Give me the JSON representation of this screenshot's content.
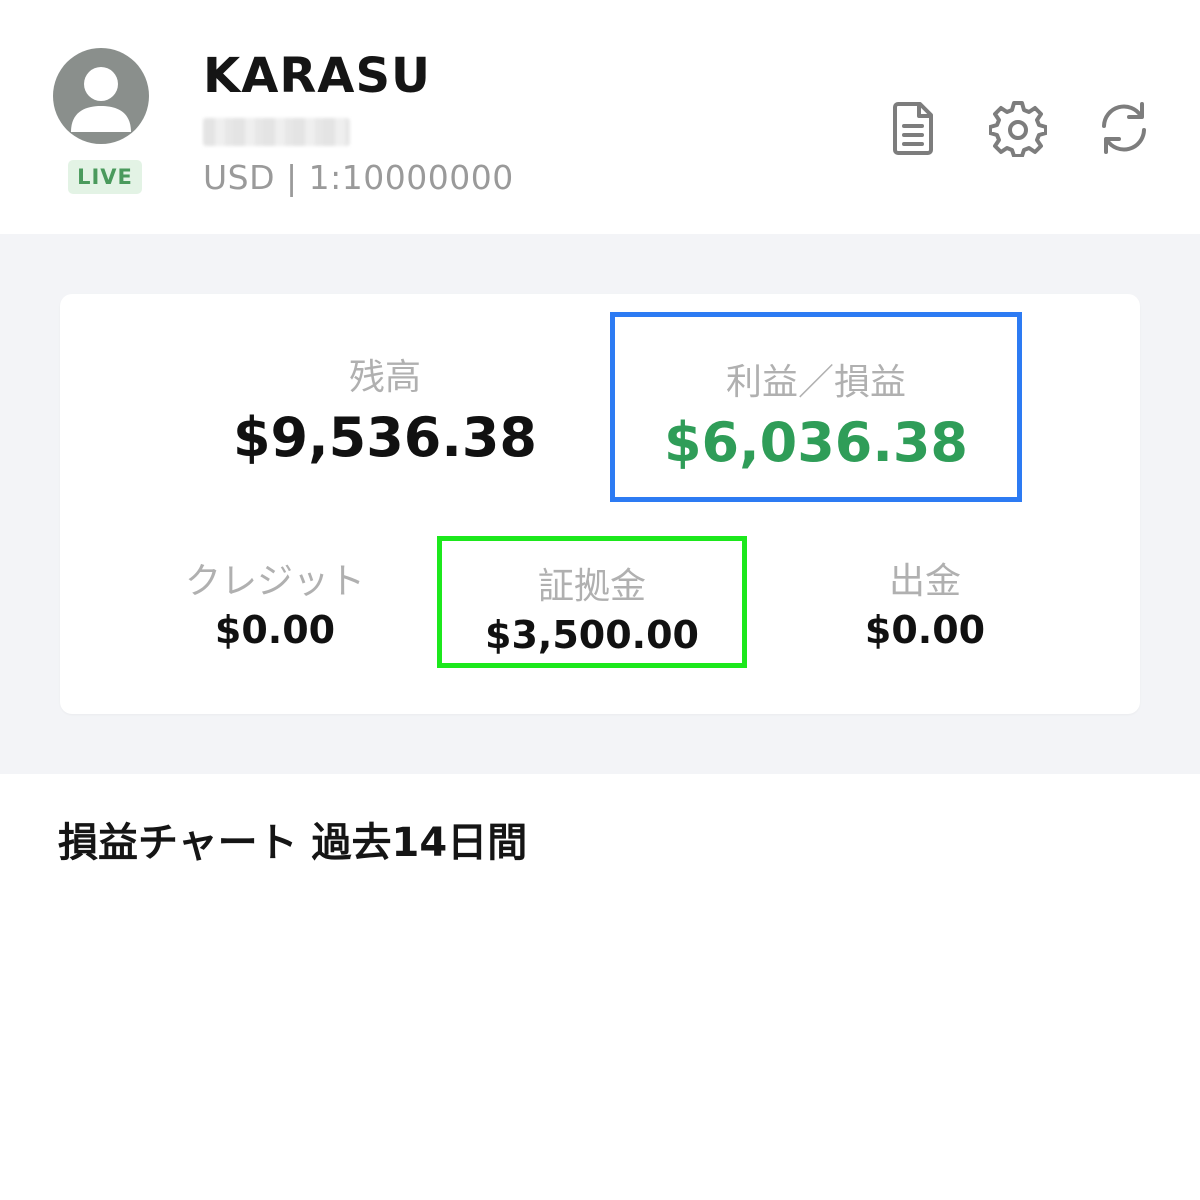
{
  "header": {
    "account_name": "KARASU",
    "badge": "LIVE",
    "meta": "USD | 1:10000000",
    "icons": [
      "document-icon",
      "gear-icon",
      "refresh-icon"
    ]
  },
  "summary": {
    "balance": {
      "label": "残高",
      "value": "$9,536.38"
    },
    "profit": {
      "label": "利益／損益",
      "value": "$6,036.38"
    },
    "credit": {
      "label": "クレジット",
      "value": "$0.00"
    },
    "margin": {
      "label": "証拠金",
      "value": "$3,500.00"
    },
    "withdrawal": {
      "label": "出金",
      "value": "$0.00"
    }
  },
  "chart_section": {
    "title": "損益チャート 過去14日間"
  },
  "colors": {
    "profit_text": "#2f9d58",
    "profit_highlight": "#2d7bf3",
    "margin_highlight": "#1ce81c",
    "live_badge_bg": "#e3f3e5",
    "live_badge_text": "#4a9a5c",
    "section_bg": "#f3f4f7"
  }
}
